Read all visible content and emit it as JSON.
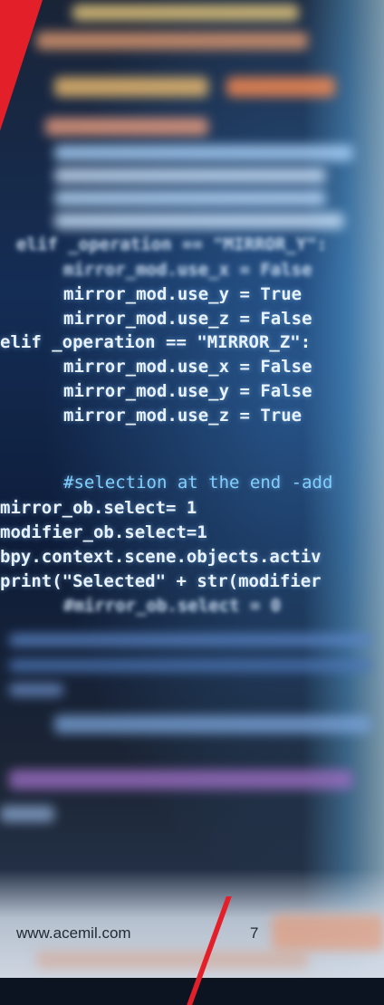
{
  "code": {
    "blurred_lines": [
      "elif _operation == \"MIRROR_Y\":",
      "mirror_mod.use_x = False"
    ],
    "lines": [
      "mirror_mod.use_y = True",
      "mirror_mod.use_z = False",
      "elif _operation == \"MIRROR_Z\":",
      "mirror_mod.use_x = False",
      "mirror_mod.use_y = False",
      "mirror_mod.use_z = True",
      "#selection at the end -add",
      "mirror_ob.select= 1",
      "modifier_ob.select=1",
      "bpy.context.scene.objects.activ",
      "print(\"Selected\" + str(modifier"
    ],
    "faded_line": "#mirror_ob.select = 0"
  },
  "footer": {
    "website": "www.acemil.com",
    "page_number": "7"
  },
  "colors": {
    "accent": "#e3202a"
  }
}
